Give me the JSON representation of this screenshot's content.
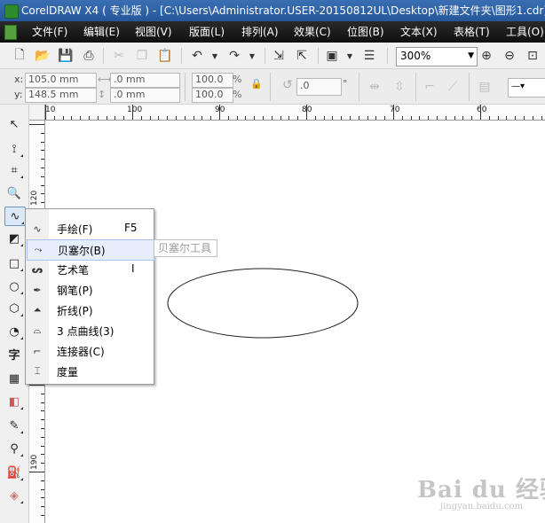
{
  "window": {
    "title": "CorelDRAW X4 ( 专业版 ) - [C:\\Users\\Administrator.USER-20150812UL\\Desktop\\新建文件夹\\图形1.cdr]"
  },
  "menu": [
    {
      "label": "文件(F)"
    },
    {
      "label": "编辑(E)"
    },
    {
      "label": "视图(V)"
    },
    {
      "label": "版面(L)"
    },
    {
      "label": "排列(A)"
    },
    {
      "label": "效果(C)"
    },
    {
      "label": "位图(B)"
    },
    {
      "label": "文本(X)"
    },
    {
      "label": "表格(T)"
    },
    {
      "label": "工具(O)"
    }
  ],
  "toolbar": {
    "zoom_value": "300%"
  },
  "property_bar": {
    "x_label": "x:",
    "y_label": "y:",
    "x_value": "105.0 mm",
    "y_value": "148.5 mm",
    "w_value": ".0 mm",
    "h_value": ".0 mm",
    "scale_w": "100.0",
    "scale_h": "100.0",
    "percent": "%",
    "rotation": ".0",
    "degree": "°"
  },
  "ruler": {
    "h_labels": [
      "10",
      "100",
      "90",
      "80",
      "70",
      "60"
    ],
    "v_labels": [
      "120",
      "190"
    ]
  },
  "flyout": {
    "items": [
      {
        "icon": "freehand-icon",
        "label": "手绘(F)",
        "shortcut": "F5"
      },
      {
        "icon": "bezier-icon",
        "label": "贝塞尔(B)",
        "shortcut": ""
      },
      {
        "icon": "artistic-media-icon",
        "label": "艺术笔",
        "shortcut": "I"
      },
      {
        "icon": "pen-icon",
        "label": "钢笔(P)",
        "shortcut": ""
      },
      {
        "icon": "polyline-icon",
        "label": "折线(P)",
        "shortcut": ""
      },
      {
        "icon": "three-point-curve-icon",
        "label": "3 点曲线(3)",
        "shortcut": ""
      },
      {
        "icon": "connector-icon",
        "label": "连接器(C)",
        "shortcut": ""
      },
      {
        "icon": "dimension-icon",
        "label": "度量",
        "shortcut": ""
      }
    ],
    "tooltip": "贝塞尔工具"
  },
  "watermark": {
    "logo": "Bai du 经验",
    "url": "jingyan.baidu.com"
  }
}
